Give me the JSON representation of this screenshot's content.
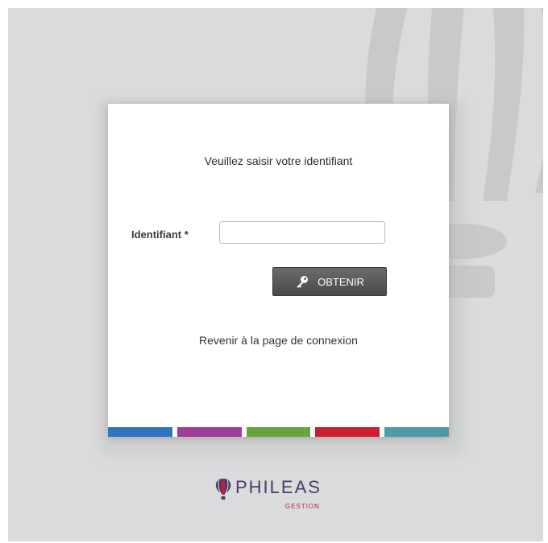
{
  "form": {
    "prompt": "Veuillez saisir votre identifiant",
    "field_label": "Identifiant *",
    "field_value": "",
    "field_placeholder": "",
    "submit_label": "OBTENIR",
    "submit_icon": "key-icon",
    "back_link": "Revenir à la page de connexion"
  },
  "stripes": [
    "#2f75c2",
    "#9d3d96",
    "#66a53b",
    "#cc1f2d",
    "#4f9aa7"
  ],
  "logo": {
    "name": "PHILEAS",
    "sub": "GESTION",
    "icon": "balloon-logo-icon",
    "colors": {
      "primary": "#4b3a6e",
      "accent": "#c3212e"
    }
  },
  "background": {
    "color": "#dadbdc",
    "icon": "balloon-watermark-icon"
  }
}
